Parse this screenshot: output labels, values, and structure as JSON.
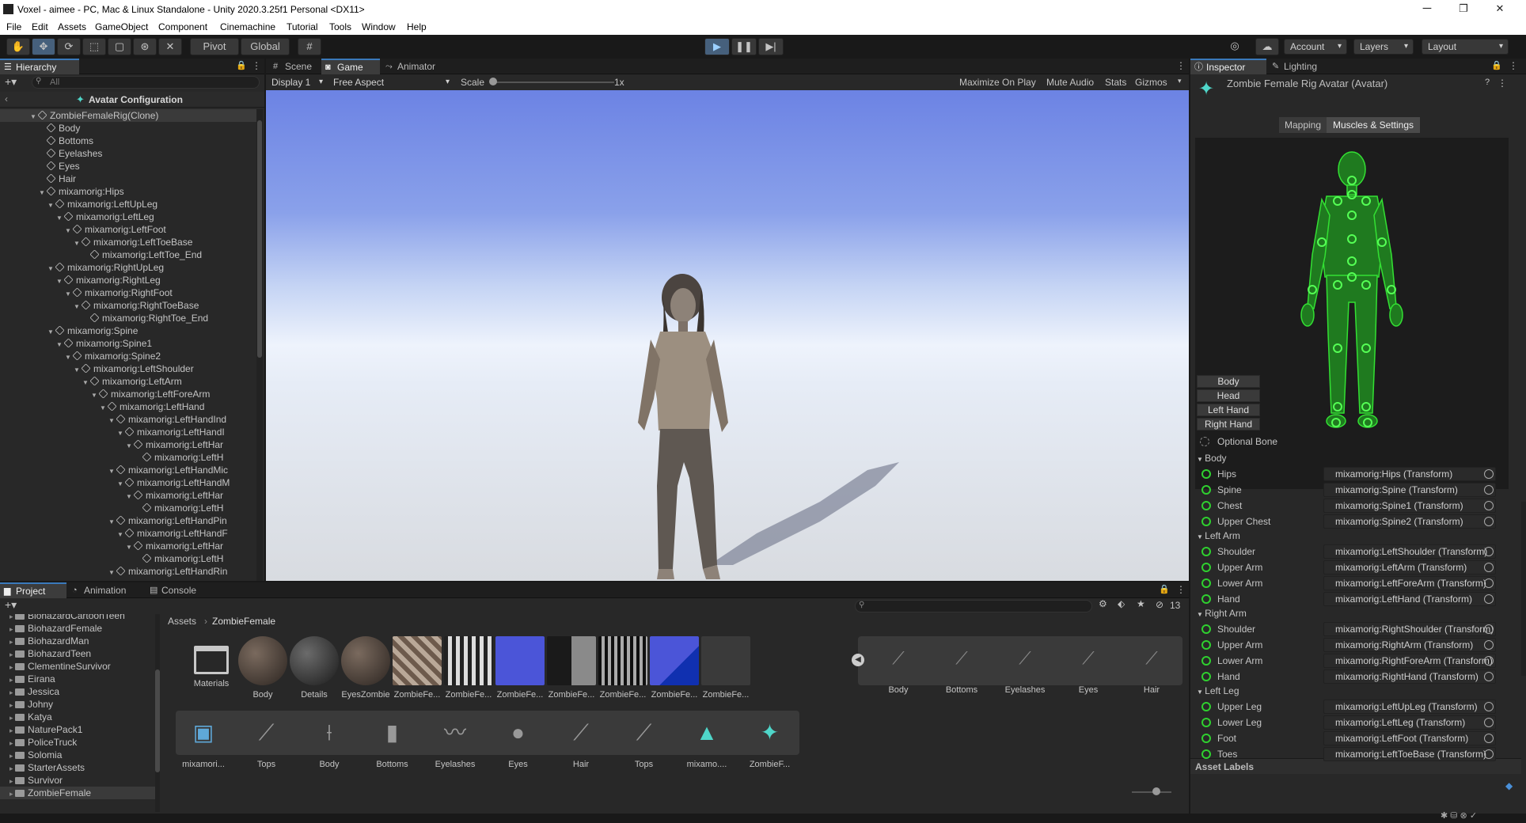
{
  "window": {
    "title": "Voxel - aimee - PC, Mac & Linux Standalone - Unity 2020.3.25f1 Personal <DX11>",
    "minimize": "─",
    "maximize": "❐",
    "close": "✕"
  },
  "menu": [
    "File",
    "Edit",
    "Assets",
    "GameObject",
    "Component",
    "Cinemachine",
    "Tutorial",
    "Tools",
    "Window",
    "Help"
  ],
  "toolbar": {
    "pivot": "Pivot",
    "global": "Global",
    "account": "Account",
    "layers": "Layers",
    "layout": "Layout"
  },
  "hierarchy": {
    "tab": "Hierarchy",
    "search_placeholder": "All",
    "header": "Avatar Configuration",
    "rows": [
      {
        "label": "ZombieFemaleRig(Clone)",
        "depth": 0,
        "arrow": true
      },
      {
        "label": "Body",
        "depth": 1,
        "arrow": false
      },
      {
        "label": "Bottoms",
        "depth": 1,
        "arrow": false
      },
      {
        "label": "Eyelashes",
        "depth": 1,
        "arrow": false
      },
      {
        "label": "Eyes",
        "depth": 1,
        "arrow": false
      },
      {
        "label": "Hair",
        "depth": 1,
        "arrow": false
      },
      {
        "label": "mixamorig:Hips",
        "depth": 1,
        "arrow": true
      },
      {
        "label": "mixamorig:LeftUpLeg",
        "depth": 2,
        "arrow": true
      },
      {
        "label": "mixamorig:LeftLeg",
        "depth": 3,
        "arrow": true
      },
      {
        "label": "mixamorig:LeftFoot",
        "depth": 4,
        "arrow": true
      },
      {
        "label": "mixamorig:LeftToeBase",
        "depth": 5,
        "arrow": true
      },
      {
        "label": "mixamorig:LeftToe_End",
        "depth": 6,
        "arrow": false
      },
      {
        "label": "mixamorig:RightUpLeg",
        "depth": 2,
        "arrow": true
      },
      {
        "label": "mixamorig:RightLeg",
        "depth": 3,
        "arrow": true
      },
      {
        "label": "mixamorig:RightFoot",
        "depth": 4,
        "arrow": true
      },
      {
        "label": "mixamorig:RightToeBase",
        "depth": 5,
        "arrow": true
      },
      {
        "label": "mixamorig:RightToe_End",
        "depth": 6,
        "arrow": false
      },
      {
        "label": "mixamorig:Spine",
        "depth": 2,
        "arrow": true
      },
      {
        "label": "mixamorig:Spine1",
        "depth": 3,
        "arrow": true
      },
      {
        "label": "mixamorig:Spine2",
        "depth": 4,
        "arrow": true
      },
      {
        "label": "mixamorig:LeftShoulder",
        "depth": 5,
        "arrow": true
      },
      {
        "label": "mixamorig:LeftArm",
        "depth": 6,
        "arrow": true
      },
      {
        "label": "mixamorig:LeftForeArm",
        "depth": 7,
        "arrow": true
      },
      {
        "label": "mixamorig:LeftHand",
        "depth": 8,
        "arrow": true
      },
      {
        "label": "mixamorig:LeftHandInd",
        "depth": 9,
        "arrow": true
      },
      {
        "label": "mixamorig:LeftHandI",
        "depth": 10,
        "arrow": true
      },
      {
        "label": "mixamorig:LeftHar",
        "depth": 11,
        "arrow": true
      },
      {
        "label": "mixamorig:LeftH",
        "depth": 12,
        "arrow": false
      },
      {
        "label": "mixamorig:LeftHandMic",
        "depth": 9,
        "arrow": true
      },
      {
        "label": "mixamorig:LeftHandM",
        "depth": 10,
        "arrow": true
      },
      {
        "label": "mixamorig:LeftHar",
        "depth": 11,
        "arrow": true
      },
      {
        "label": "mixamorig:LeftH",
        "depth": 12,
        "arrow": false
      },
      {
        "label": "mixamorig:LeftHandPin",
        "depth": 9,
        "arrow": true
      },
      {
        "label": "mixamorig:LeftHandF",
        "depth": 10,
        "arrow": true
      },
      {
        "label": "mixamorig:LeftHar",
        "depth": 11,
        "arrow": true
      },
      {
        "label": "mixamorig:LeftH",
        "depth": 12,
        "arrow": false
      },
      {
        "label": "mixamorig:LeftHandRin",
        "depth": 9,
        "arrow": true
      }
    ]
  },
  "game": {
    "tabs": [
      "Scene",
      "Game",
      "Animator"
    ],
    "display": "Display 1",
    "aspect": "Free Aspect",
    "scale_label": "Scale",
    "scale_value": "1x",
    "maximize": "Maximize On Play",
    "mute": "Mute Audio",
    "stats": "Stats",
    "gizmos": "Gizmos"
  },
  "project": {
    "tabs": [
      "Project",
      "Animation",
      "Console"
    ],
    "hidden_count": "13",
    "breadcrumb_root": "Assets",
    "breadcrumb_current": "ZombieFemale",
    "folders": [
      "BiohazardCartoonTeen",
      "BiohazardFemale",
      "BiohazardMan",
      "BiohazardTeen",
      "ClementineSurvivor",
      "Eirana",
      "Jessica",
      "Johny",
      "Katya",
      "NaturePack1",
      "PoliceTruck",
      "Solomia",
      "StarterAssets",
      "Survivor",
      "ZombieFemale"
    ],
    "assets_row1": [
      "Materials",
      "Body",
      "Details",
      "EyesZombie",
      "ZombieFe...",
      "ZombieFe...",
      "ZombieFe...",
      "ZombieFe...",
      "ZombieFe...",
      "ZombieFe...",
      "ZombieFe..."
    ],
    "subassets_row1": [
      "Body",
      "Bottoms",
      "Eyelashes",
      "Eyes",
      "Hair"
    ],
    "assets_row2": [
      "mixamori...",
      "Tops",
      "Body",
      "Bottoms",
      "Eyelashes",
      "Eyes",
      "Hair",
      "Tops",
      "mixamo....",
      "ZombieF..."
    ]
  },
  "inspector": {
    "tabs": [
      "Inspector",
      "Lighting"
    ],
    "title": "Zombie Female Rig Avatar (Avatar)",
    "mapping": "Mapping",
    "muscles": "Muscles & Settings",
    "body_buttons": [
      "Body",
      "Head",
      "Left Hand",
      "Right Hand"
    ],
    "optional_bone": "Optional Bone",
    "groups": [
      {
        "name": "Body",
        "bones": [
          [
            "Hips",
            "mixamorig:Hips (Transform)"
          ],
          [
            "Spine",
            "mixamorig:Spine (Transform)"
          ],
          [
            "Chest",
            "mixamorig:Spine1 (Transform)"
          ],
          [
            "Upper Chest",
            "mixamorig:Spine2 (Transform)"
          ]
        ]
      },
      {
        "name": "Left Arm",
        "bones": [
          [
            "Shoulder",
            "mixamorig:LeftShoulder (Transform)"
          ],
          [
            "Upper Arm",
            "mixamorig:LeftArm (Transform)"
          ],
          [
            "Lower Arm",
            "mixamorig:LeftForeArm (Transform)"
          ],
          [
            "Hand",
            "mixamorig:LeftHand (Transform)"
          ]
        ]
      },
      {
        "name": "Right Arm",
        "bones": [
          [
            "Shoulder",
            "mixamorig:RightShoulder (Transform)"
          ],
          [
            "Upper Arm",
            "mixamorig:RightArm (Transform)"
          ],
          [
            "Lower Arm",
            "mixamorig:RightForeArm (Transform)"
          ],
          [
            "Hand",
            "mixamorig:RightHand (Transform)"
          ]
        ]
      },
      {
        "name": "Left Leg",
        "bones": [
          [
            "Upper Leg",
            "mixamorig:LeftUpLeg (Transform)"
          ],
          [
            "Lower Leg",
            "mixamorig:LeftLeg (Transform)"
          ],
          [
            "Foot",
            "mixamorig:LeftFoot (Transform)"
          ],
          [
            "Toes",
            "mixamorig:LeftToeBase (Transform)"
          ]
        ]
      }
    ],
    "asset_labels": "Asset Labels"
  },
  "colors": {
    "accent": "#3a79bb",
    "bone_green": "#2fd02f",
    "sky_top": "#6f86e6",
    "sky_horizon": "#ffffff"
  }
}
